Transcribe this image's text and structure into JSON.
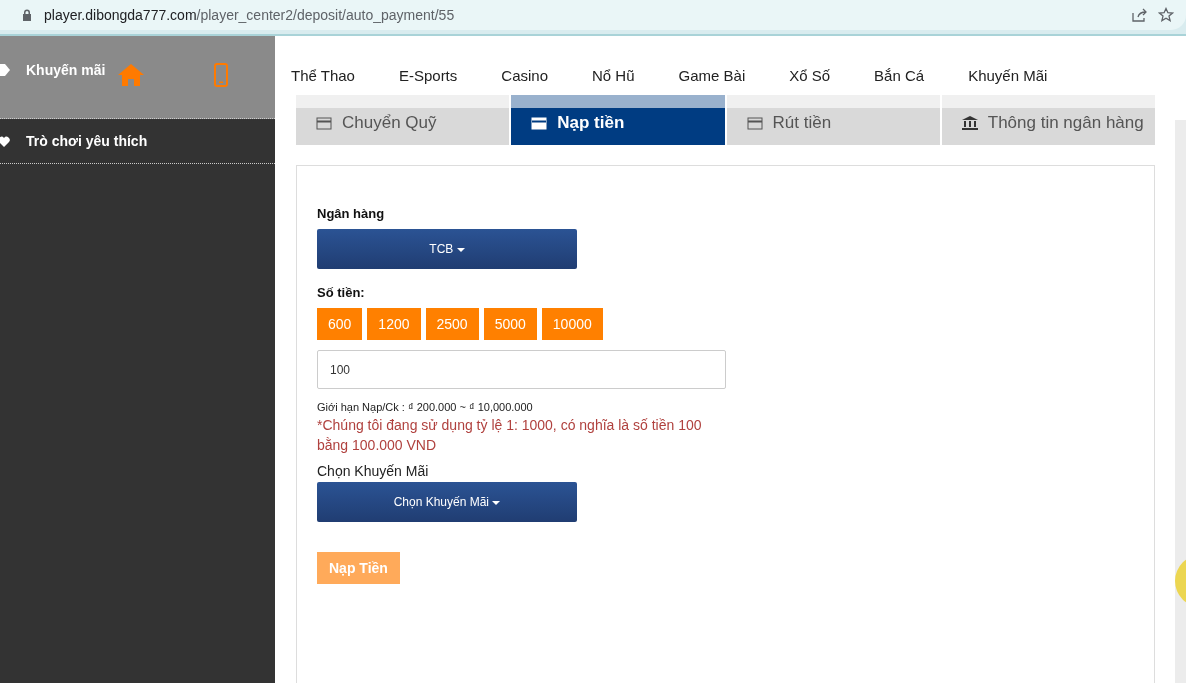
{
  "browser": {
    "url_host": "player.dibongda777.com",
    "url_path": "/player_center2/deposit/auto_payment/55"
  },
  "sidebar": {
    "items": [
      {
        "label": "Khuyến mãi",
        "kind": "tag",
        "highlighted": true
      },
      {
        "label": "Trò chơi yêu thích",
        "kind": "heart",
        "highlighted": false
      }
    ]
  },
  "nav": {
    "items": [
      "Thể Thao",
      "E-Sports",
      "Casino",
      "Nổ Hũ",
      "Game Bài",
      "Xổ Số",
      "Bắn Cá",
      "Khuyến Mãi"
    ]
  },
  "tabs": [
    {
      "label": "Chuyển Quỹ",
      "kind": "card",
      "selected": false
    },
    {
      "label": "Nạp tiền",
      "kind": "card",
      "selected": true
    },
    {
      "label": "Rút tiền",
      "kind": "card",
      "selected": false
    },
    {
      "label": "Thông tin ngân hàng",
      "kind": "bank",
      "selected": false
    }
  ],
  "form": {
    "bank_label": "Ngân hàng",
    "bank_value": "TCB",
    "amount_label": "Số tiền:",
    "presets": [
      "600",
      "1200",
      "2500",
      "5000",
      "10000"
    ],
    "amount_value": "100",
    "limit_note": "Giới hạn Nạp/Ck : ₫ 200.000 ~ ₫ 10,000.000",
    "rate_note": "*Chúng tôi đang sử dụng tỷ lệ 1: 1000, có nghĩa là số tiền 100 bằng 100.000 VND",
    "promo_label": "Chọn Khuyến Mãi",
    "promo_value": "Chọn Khuyến Mãi",
    "submit": {
      "label": "Nạp Tiền",
      "disabled": true
    }
  }
}
